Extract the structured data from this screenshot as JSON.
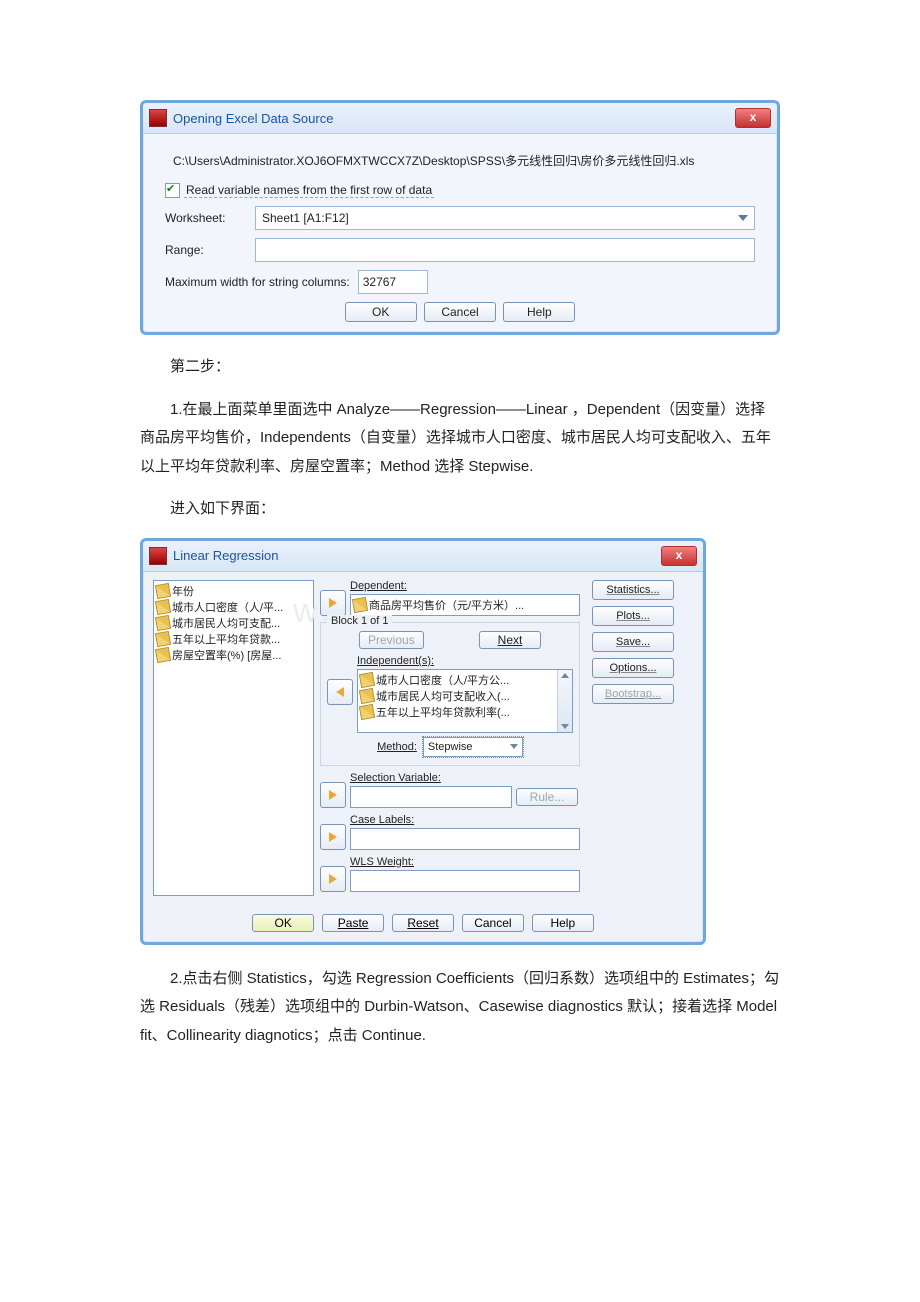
{
  "dialog1": {
    "title": "Opening Excel Data Source",
    "file_path": "C:\\Users\\Administrator.XOJ6OFMXTWCCX7Z\\Desktop\\SPSS\\多元线性回归\\房价多元线性回归.xls",
    "checkbox_label": "Read variable names from the first row of data",
    "worksheet_label": "Worksheet:",
    "worksheet_value": "Sheet1 [A1:F12]",
    "range_label": "Range:",
    "maxwidth_label": "Maximum width for string columns:",
    "maxwidth_value": "32767",
    "ok": "OK",
    "cancel": "Cancel",
    "help": "Help"
  },
  "prose": {
    "step2": "第二步：",
    "p1": "1.在最上面菜单里面选中 Analyze——Regression——Linear ，Dependent（因变量）选择商品房平均售价，Independents（自变量）选择城市人口密度、城市居民人均可支配收入、五年以上平均年贷款利率、房屋空置率；Method 选择 Stepwise.",
    "p2": "进入如下界面：",
    "p3": "2.点击右侧 Statistics，勾选 Regression Coefficients（回归系数）选项组中的 Estimates；勾选 Residuals（残差）选项组中的 Durbin-Watson、Casewise diagnostics 默认；接着选择 Model fit、Collinearity diagnotics；点击 Continue."
  },
  "dialog2": {
    "title": "Linear Regression",
    "vars": [
      "年份",
      "城市人口密度（人/平...",
      "城市居民人均可支配...",
      "五年以上平均年贷款...",
      "房屋空置率(%) [房屋..."
    ],
    "dependent_label": "Dependent:",
    "dependent_value": "商品房平均售价（元/平方米）...",
    "block_title": "Block 1 of 1",
    "previous": "Previous",
    "next_label": "Next",
    "independent_label": "Independent(s):",
    "independents": [
      "城市人口密度（人/平方公...",
      "城市居民人均可支配收入(...",
      "五年以上平均年贷款利率(..."
    ],
    "method_label": "Method:",
    "method_value": "Stepwise",
    "selvar_label": "Selection Variable:",
    "rule_btn": "Rule...",
    "caselabels_label": "Case Labels:",
    "wls_label": "WLS Weight:",
    "side": {
      "statistics": "Statistics...",
      "plots": "Plots...",
      "save": "Save...",
      "options": "Options...",
      "bootstrap": "Bootstrap..."
    },
    "bottom": {
      "ok": "OK",
      "paste": "Paste",
      "reset": "Reset",
      "cancel": "Cancel",
      "help": "Help"
    }
  }
}
